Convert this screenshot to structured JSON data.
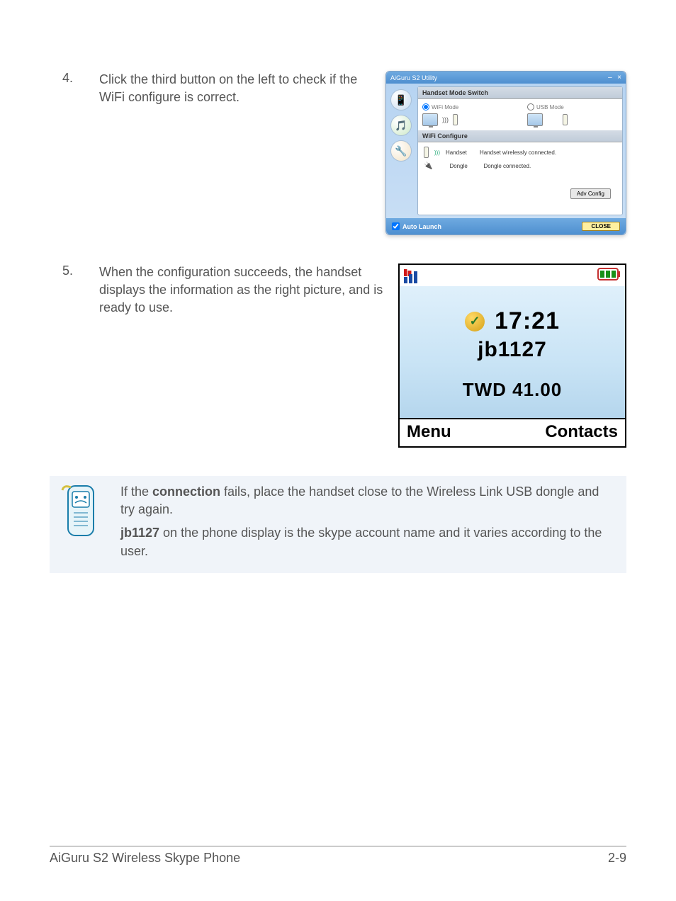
{
  "steps": {
    "s4": {
      "num": "4.",
      "text": "Click the third button on the left to check if the WiFi configure is correct."
    },
    "s5": {
      "num": "5.",
      "text": "When the configuration succeeds, the handset displays the information as the right picture, and is ready to use."
    }
  },
  "utility": {
    "title": "AiGuru S2 Utility",
    "min": "–",
    "close": "×",
    "hms_header": "Handset Mode Switch",
    "wifi_mode": "WiFi Mode",
    "usb_mode": "USB Mode",
    "wifi_cfg_header": "WiFi Configure",
    "handset_label": "Handset",
    "handset_status": "Handset wirelessly connected.",
    "dongle_label": "Dongle",
    "dongle_status": "Dongle connected.",
    "adv_config": "Adv Config",
    "auto_launch": "Auto Launch",
    "close_btn": "CLOSE"
  },
  "handset": {
    "time": "17:21",
    "account": "jb1127",
    "balance": "TWD 41.00",
    "left_key": "Menu",
    "right_key": "Contacts"
  },
  "note": {
    "p1_a": "If the ",
    "p1_b": "connection",
    "p1_c": " fails, place the handset close to the Wireless Link USB dongle and try again.",
    "p2_a": "jb1127",
    "p2_b": " on the phone display is the skype account name and it varies according to the user."
  },
  "footer": {
    "left": "AiGuru S2 Wireless Skype Phone",
    "right": "2-9"
  }
}
